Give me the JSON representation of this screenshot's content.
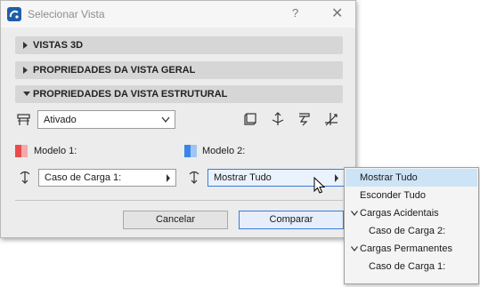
{
  "window": {
    "title": "Selecionar Vista",
    "help_glyph": "?",
    "close_glyph": "✕"
  },
  "sections": {
    "views_3d": "VISTAS 3D",
    "general_props": "PROPRIEDADES DA VISTA GERAL",
    "structural_props": "PROPRIEDADES DA VISTA ESTRUTURAL"
  },
  "state_dropdown": {
    "value": "Ativado"
  },
  "model1": {
    "label": "Modelo 1:",
    "color": "#e84c4c",
    "dropdown": "Caso de Carga 1:"
  },
  "model2": {
    "label": "Modelo 2:",
    "color": "#3a86e8",
    "dropdown": "Mostrar Tudo"
  },
  "buttons": {
    "cancel": "Cancelar",
    "compare": "Comparar"
  },
  "menu": {
    "show_all": "Mostrar Tudo",
    "hide_all": "Esconder Tudo",
    "accidental_loads": "Cargas Acidentais",
    "load_case_2": "Caso de Carga 2:",
    "permanent_loads": "Cargas Permanentes",
    "load_case_1": "Caso de Carga 1:"
  }
}
